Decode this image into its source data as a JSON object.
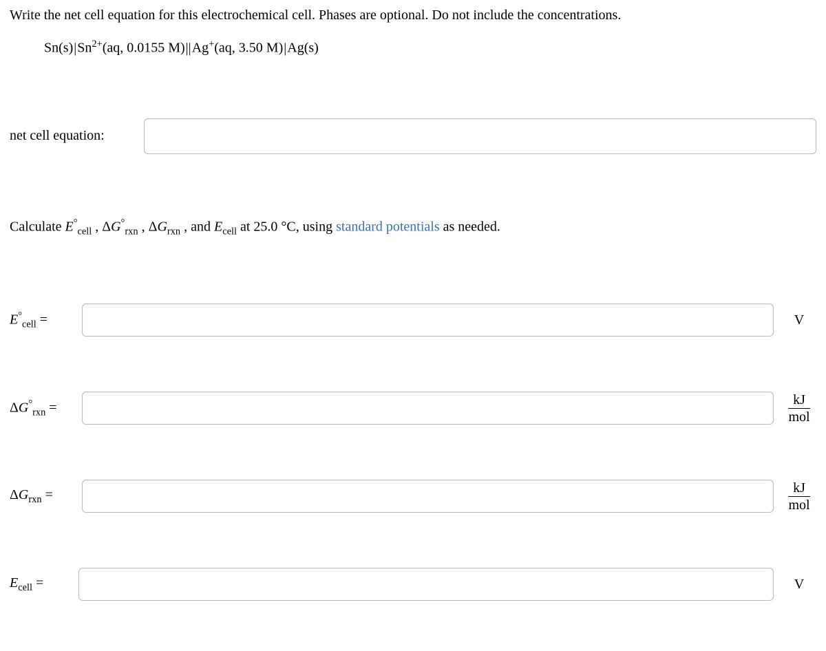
{
  "question": {
    "intro": "Write the net cell equation for this electrochemical cell. Phases are optional. Do not include the concentrations.",
    "notation": {
      "part1": "Sn(s)",
      "part2_pre": "Sn",
      "part2_sup": "2+",
      "part2_post": "(aq, 0.0155 M)",
      "part3_pre": "Ag",
      "part3_sup": "+",
      "part3_post": "(aq, 3.50 M)",
      "part4": "Ag(s)"
    },
    "net_cell_label": "net cell equation:",
    "calculate_pre": "Calculate ",
    "calculate_post": " at 25.0 °C, using ",
    "calculate_link": "standard potentials",
    "calculate_end": " as needed.",
    "and": " and ",
    "comma": " , "
  },
  "terms": {
    "E": "E",
    "deltaG": "Δ",
    "G": "G",
    "cell": "cell",
    "rxn": "rxn",
    "degree": "°"
  },
  "labels": {
    "e_std_cell_sym": "E",
    "dg_std_rxn_sym": "ΔG",
    "dg_rxn_sym": "ΔG",
    "e_cell_sym": "E",
    "equals": " ="
  },
  "units": {
    "V": "V",
    "kJ": "kJ",
    "mol": "mol"
  }
}
